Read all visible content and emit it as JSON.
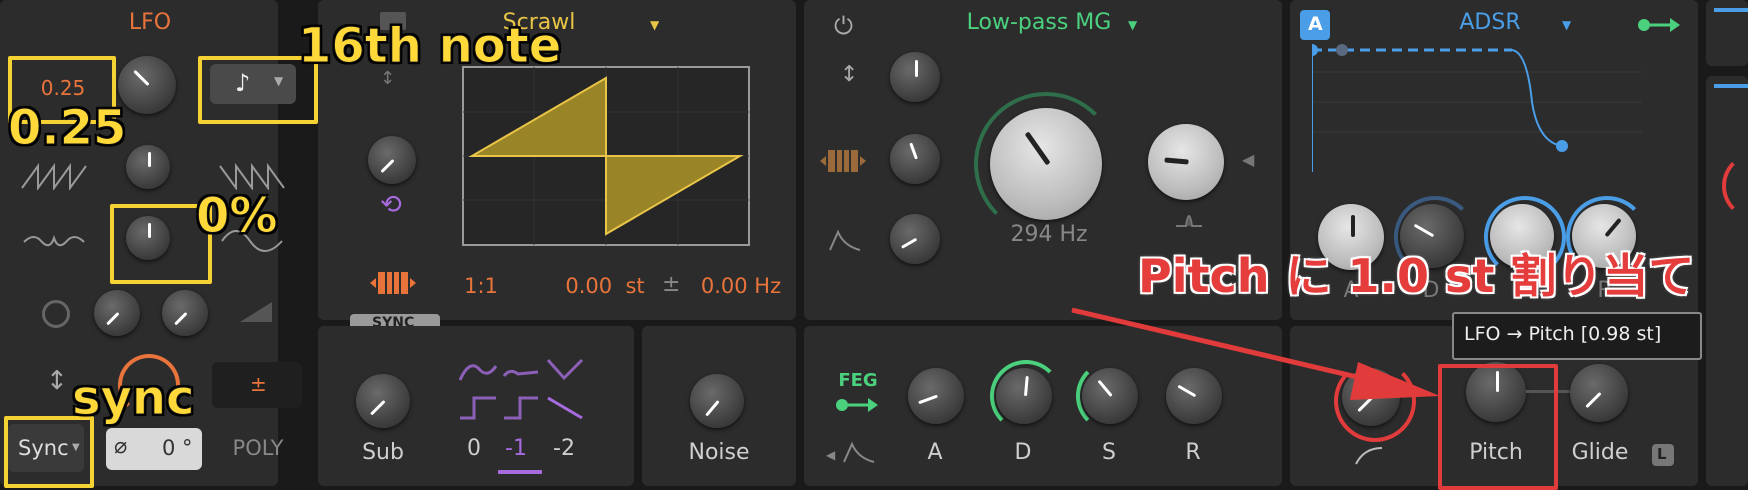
{
  "lfo": {
    "title": "LFO",
    "rate_value": "0.25",
    "sync_mode": "Sync",
    "phase": "0 °",
    "phase_symbol": "⌀",
    "poly": "POLY",
    "bipolar": "±"
  },
  "osc": {
    "wave_name": "Scrawl",
    "ratio": "1:1",
    "semitone": "0.00  st",
    "fine_symbol": "±",
    "fine": "0.00 Hz",
    "sync_badge": "SYNC"
  },
  "sub": {
    "label": "Sub",
    "oct0": "0",
    "oct1": "-1",
    "oct2": "-2"
  },
  "noise": {
    "label": "Noise"
  },
  "filter": {
    "title": "Low-pass MG",
    "cutoff": "294 Hz"
  },
  "feg": {
    "label": "FEG",
    "a": "A",
    "d": "D",
    "s": "S",
    "r": "R"
  },
  "adsr": {
    "badge": "A",
    "title": "ADSR",
    "a": "A",
    "d": "D",
    "s": "S",
    "r": "R"
  },
  "pitch": {
    "label": "Pitch",
    "glide": "Glide",
    "l_badge": "L",
    "tooltip": "LFO → Pitch [0.98 st]"
  },
  "annotations": {
    "rate": "0.25",
    "note": "16th note",
    "percent": "0%",
    "sync": "sync",
    "pitch_assign": "Pitch に 1.0 st 割り当て"
  },
  "colors": {
    "accent_orange": "#e8743b",
    "accent_yellow": "#e8c547",
    "accent_green": "#4bd17e",
    "accent_blue": "#4a9ee8",
    "annotation_yellow": "#f6d232",
    "annotation_red": "#e23b3b"
  }
}
